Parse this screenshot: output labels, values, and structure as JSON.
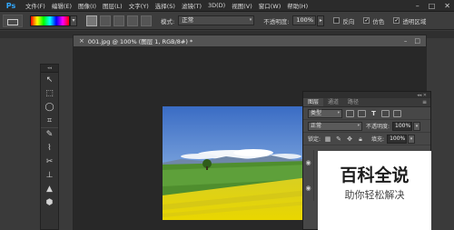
{
  "app": {
    "logo": "Ps"
  },
  "menu": [
    "文件(F)",
    "编辑(E)",
    "图像(I)",
    "图层(L)",
    "文字(Y)",
    "选择(S)",
    "滤镜(T)",
    "3D(D)",
    "视图(V)",
    "窗口(W)",
    "帮助(H)"
  ],
  "window_controls": {
    "minimize": "–",
    "maximize": "□",
    "close": "✕"
  },
  "options_bar": {
    "mode_label": "模式:",
    "mode_value": "正常",
    "opacity_label": "不透明度:",
    "opacity_value": "100%",
    "reverse_label": "反向",
    "dither_label": "仿色",
    "dither_checked": "✓",
    "transparency_label": "透明区域",
    "transparency_checked": "✓"
  },
  "document": {
    "close_glyph": "×",
    "title": "001.jpg @ 100% (图层 1, RGB/8#) *"
  },
  "tools": [
    "↖",
    "⬚",
    "◯",
    "⌗",
    "✎",
    "⌇",
    "✂",
    "⊥",
    "▲",
    "⬢"
  ],
  "layers_panel": {
    "tabs": [
      "图层",
      "通道",
      "路径"
    ],
    "menu_glyph": "≡",
    "filter_kind": "类型",
    "blend_mode": "正常",
    "opacity_label": "不透明度:",
    "opacity_value": "100%",
    "lock_label": "锁定:",
    "fill_label": "填充:",
    "fill_value": "100%",
    "eye_glyph": "◉",
    "text_filter_glyph": "T"
  },
  "watermark": {
    "main": "百科全说",
    "sub": "助你轻松解决"
  },
  "colors": {
    "ps_blue": "#31a8ff",
    "sky_top": "#3f73c8",
    "field_yellow": "#e2d300"
  }
}
